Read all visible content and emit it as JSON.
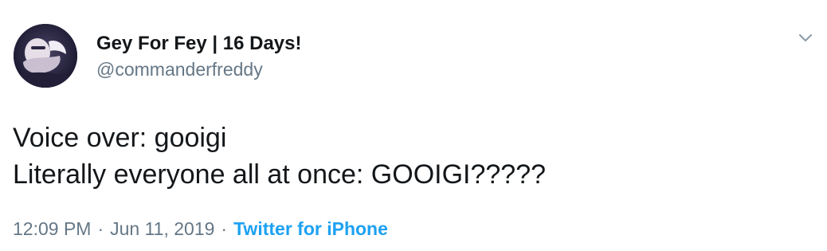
{
  "user": {
    "display_name": "Gey For Fey | 16 Days!",
    "handle": "@commanderfreddy",
    "avatar_icon": "profile-avatar-icon"
  },
  "header": {
    "menu_icon": "chevron-down-icon"
  },
  "tweet": {
    "lines": [
      "Voice over: gooigi",
      "Literally everyone all at once: GOOIGI?????"
    ]
  },
  "meta": {
    "time": "12:09 PM",
    "separator": "·",
    "date": "Jun 11, 2019",
    "source": "Twitter for iPhone"
  },
  "colors": {
    "text": "#14171a",
    "secondary": "#657786",
    "link": "#1da1f2",
    "background": "#ffffff"
  }
}
